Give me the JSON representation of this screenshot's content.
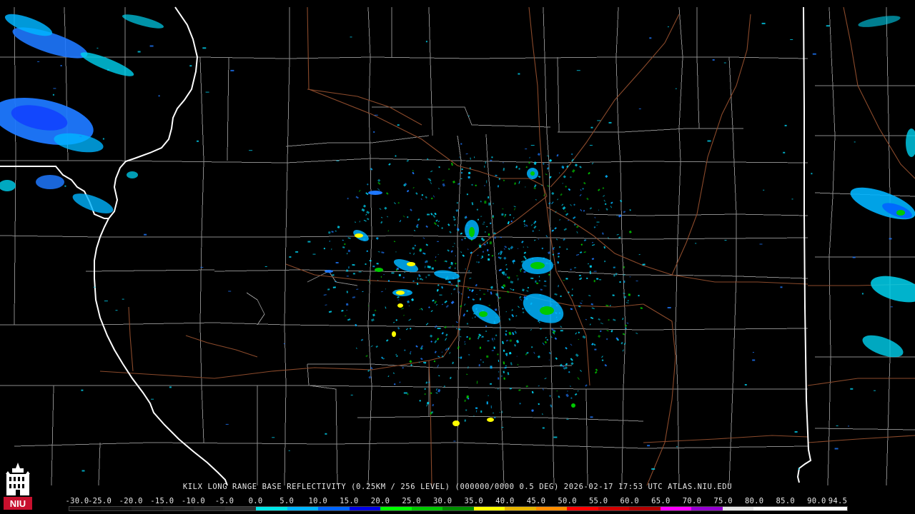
{
  "product_caption": "KILX LONG RANGE BASE REFLECTIVITY (0.25KM / 256 LEVEL) (000000/0000 0.5 DEG) 2026-02-17 17:53 UTC  ATLAS.NIU.EDU",
  "colorbar": {
    "ticks": [
      "-30.0",
      "-25.0",
      "-20.0",
      "-15.0",
      "-10.0",
      "-5.0",
      "0.0",
      "5.0",
      "10.0",
      "15.0",
      "20.0",
      "25.0",
      "30.0",
      "35.0",
      "40.0",
      "45.0",
      "50.0",
      "55.0",
      "60.0",
      "65.0",
      "70.0",
      "75.0",
      "80.0",
      "85.0",
      "90.0",
      "94.5"
    ],
    "colors": [
      "#0a0a0a",
      "#101010",
      "#181818",
      "#202020",
      "#282828",
      "#303030",
      "#00e6e6",
      "#00b4ff",
      "#0064ff",
      "#0000e6",
      "#00ff00",
      "#00c800",
      "#008c00",
      "#ffff00",
      "#e6b400",
      "#ff8c00",
      "#ff0000",
      "#d20000",
      "#b40000",
      "#ff00ff",
      "#9600d2",
      "#e6e6e6",
      "#ffffff",
      "#ffffff",
      "#ffffff"
    ]
  },
  "logo": {
    "text": "NIU",
    "accent_color": "#c8102e"
  },
  "map_colors": {
    "background": "#000000",
    "county_lines": "#8a8a8a",
    "state_lines": "#ffffff",
    "highways": "#8b4a2b",
    "echo_light": "#00d2f0",
    "echo_blue": "#1e78ff",
    "echo_green": "#00d200",
    "echo_yellow": "#ffff00"
  }
}
